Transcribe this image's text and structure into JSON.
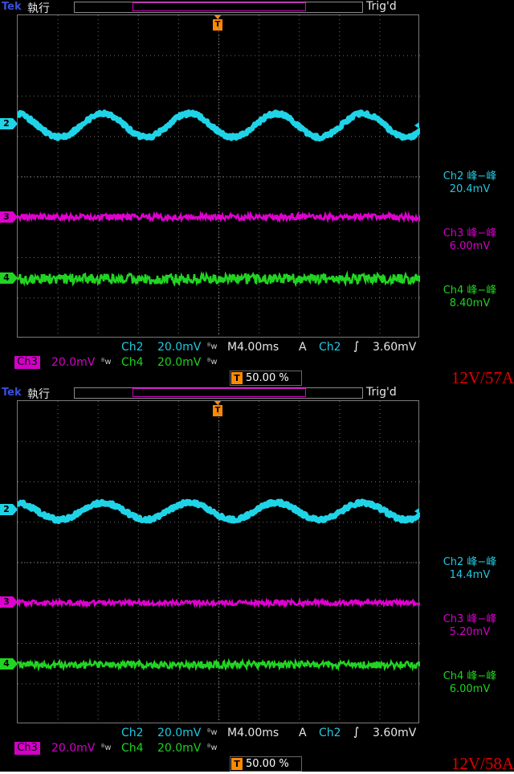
{
  "panels": [
    {
      "app_brand": "Tek",
      "run_state": "執行",
      "trigger_status": "Trig'd",
      "trigger_flag": "T",
      "channel_markers": [
        "2",
        "3",
        "4"
      ],
      "measurements": [
        {
          "label": "Ch2 峰−峰",
          "value": "20.4mV"
        },
        {
          "label": "Ch3 峰−峰",
          "value": "6.00mV"
        },
        {
          "label": "Ch4 峰−峰",
          "value": "8.40mV"
        }
      ],
      "ch2_scale_label": "Ch2",
      "ch2_scale": "20.0mV",
      "ch3_scale_label": "Ch3",
      "ch3_scale": "20.0mV",
      "ch4_scale_label": "Ch4",
      "ch4_scale": "20.0mV",
      "bw_symbol": "ᴮw",
      "timebase": "M4.00ms",
      "trigger_mode": "A",
      "trigger_source": "Ch2",
      "trigger_slope": "∫",
      "trigger_level": "3.60mV",
      "trigger_position": "50.00 %",
      "caption": "12V/57A",
      "ch2_amplitude_fraction": 0.58,
      "ch3_amplitude_fraction": 0.15,
      "ch4_amplitude_fraction": 0.25
    },
    {
      "app_brand": "Tek",
      "run_state": "執行",
      "trigger_status": "Trig'd",
      "trigger_flag": "T",
      "channel_markers": [
        "2",
        "3",
        "4"
      ],
      "measurements": [
        {
          "label": "Ch2 峰−峰",
          "value": "14.4mV"
        },
        {
          "label": "Ch3 峰−峰",
          "value": "5.20mV"
        },
        {
          "label": "Ch4 峰−峰",
          "value": "6.00mV"
        }
      ],
      "ch2_scale_label": "Ch2",
      "ch2_scale": "20.0mV",
      "ch3_scale_label": "Ch3",
      "ch3_scale": "20.0mV",
      "ch4_scale_label": "Ch4",
      "ch4_scale": "20.0mV",
      "bw_symbol": "ᴮw",
      "timebase": "M4.00ms",
      "trigger_mode": "A",
      "trigger_source": "Ch2",
      "trigger_slope": "∫",
      "trigger_level": "3.60mV",
      "trigger_position": "50.00 %",
      "caption": "12V/58A",
      "ch2_amplitude_fraction": 0.42,
      "ch3_amplitude_fraction": 0.12,
      "ch4_amplitude_fraction": 0.17
    }
  ],
  "colors": {
    "ch2": "#20d4e8",
    "ch3": "#e000d0",
    "ch4": "#22d422",
    "trigger": "#ff8a00",
    "caption": "#e00000"
  }
}
